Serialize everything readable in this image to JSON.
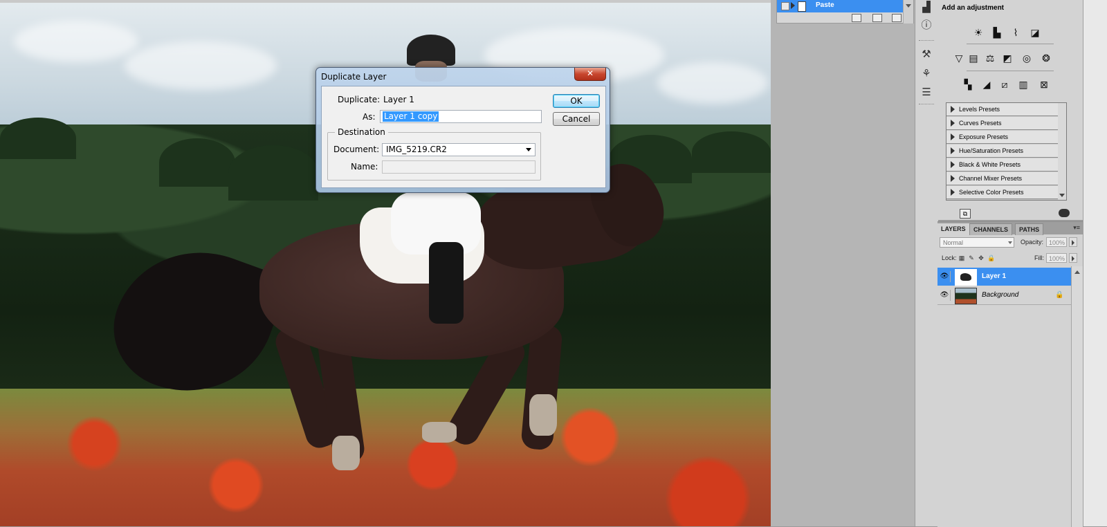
{
  "dialog": {
    "title": "Duplicate Layer",
    "close_glyph": "✕",
    "duplicate_label": "Duplicate:",
    "duplicate_value": "Layer 1",
    "as_label": "As:",
    "as_value": "Layer 1 copy",
    "ok_label": "OK",
    "cancel_label": "Cancel",
    "destination_legend": "Destination",
    "document_label": "Document:",
    "document_value": "IMG_5219.CR2",
    "name_label": "Name:",
    "name_value": ""
  },
  "history": {
    "item": "Paste"
  },
  "adjustments": {
    "header": "Add an adjustment",
    "presets": [
      "Levels Presets",
      "Curves Presets",
      "Exposure Presets",
      "Hue/Saturation Presets",
      "Black & White Presets",
      "Channel Mixer Presets",
      "Selective Color Presets"
    ]
  },
  "layers_panel": {
    "tabs": [
      "LAYERS",
      "CHANNELS",
      "PATHS"
    ],
    "blend_mode": "Normal",
    "opacity_label": "Opacity:",
    "opacity_value": "100%",
    "lock_label": "Lock:",
    "fill_label": "Fill:",
    "fill_value": "100%",
    "layers": [
      {
        "name": "Layer 1",
        "selected": true
      },
      {
        "name": "Background",
        "selected": false,
        "locked": true
      }
    ]
  },
  "colors": {
    "selection_blue": "#3b8ff0",
    "text_selection": "#3399ff",
    "close_red": "#c8462e"
  }
}
